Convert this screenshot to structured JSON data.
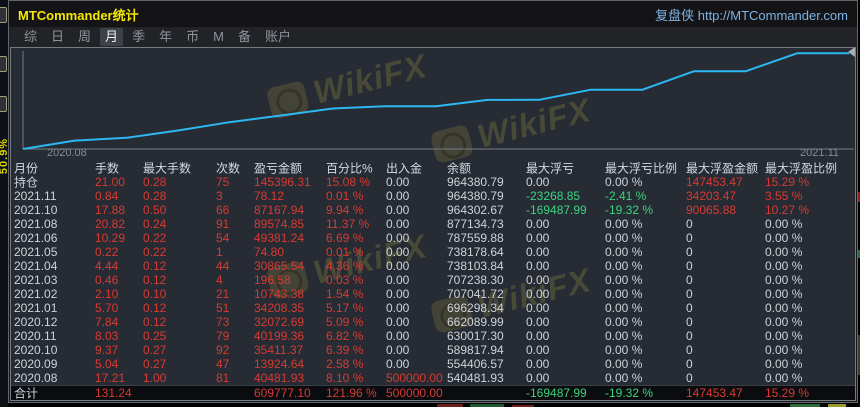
{
  "window": {
    "title": "MTCommander统计",
    "brand": "复盘侠 http://MTCommander.com"
  },
  "side_panel": {
    "label": "50.9%"
  },
  "menu": {
    "items": [
      {
        "label": "综",
        "active": false
      },
      {
        "label": "日",
        "active": false
      },
      {
        "label": "周",
        "active": false
      },
      {
        "label": "月",
        "active": true
      },
      {
        "label": "季",
        "active": false
      },
      {
        "label": "年",
        "active": false
      },
      {
        "label": "币",
        "active": false
      },
      {
        "label": "M",
        "active": false
      },
      {
        "label": "备",
        "active": false
      },
      {
        "label": "账户",
        "active": false
      }
    ]
  },
  "watermark": {
    "text": "WikiFX"
  },
  "chart_data": {
    "type": "line",
    "title": "",
    "xlabel": "",
    "ylabel": "",
    "x": [
      "2020.08",
      "2020.09",
      "2020.10",
      "2020.11",
      "2020.12",
      "2021.01",
      "2021.02",
      "2021.03",
      "2021.04",
      "2021.05",
      "2021.06",
      "2021.07",
      "2021.08",
      "2021.09",
      "2021.10",
      "2021.11"
    ],
    "x_tick_labels_shown": [
      "2020.08",
      "2021.11"
    ],
    "start_value": 500000.0,
    "series": [
      {
        "name": "余额",
        "values": [
          540481.93,
          554406.57,
          589817.94,
          630017.3,
          662089.99,
          696298.34,
          707041.72,
          707238.3,
          738103.84,
          738178.64,
          787559.88,
          787559.88,
          877134.73,
          877134.73,
          964302.67,
          964380.79
        ]
      }
    ],
    "ylim": [
      500000,
      970000
    ],
    "grid": false,
    "legend_position": "none",
    "line_color": "#2cb8f2"
  },
  "colors": {
    "title_yellow": "#f5e900",
    "brand_blue": "#7fb3e4",
    "profit_red": "#d83b32",
    "loss_green": "#3bd47e",
    "neutral_text": "#cfd3d9",
    "equity_line": "#2cb8f2"
  },
  "table": {
    "headers": [
      "月份",
      "手数",
      "最大手数",
      "次数",
      "盈亏金额",
      "百分比%",
      "出入金",
      "余额",
      "最大浮亏",
      "最大浮亏比例",
      "最大浮盈金额",
      "最大浮盈比例"
    ],
    "rows": [
      {
        "cells": [
          {
            "t": "持仓",
            "c": "l"
          },
          {
            "t": "21.00",
            "c": "r"
          },
          {
            "t": "0.28",
            "c": "r"
          },
          {
            "t": "75",
            "c": "r"
          },
          {
            "t": "145396.31",
            "c": "r"
          },
          {
            "t": "15.08 %",
            "c": "r"
          },
          {
            "t": "0.00",
            "c": "w"
          },
          {
            "t": "964380.79",
            "c": "w"
          },
          {
            "t": "0.00",
            "c": "w"
          },
          {
            "t": "0.00 %",
            "c": "w"
          },
          {
            "t": "147453.47",
            "c": "r"
          },
          {
            "t": "15.29 %",
            "c": "r"
          }
        ]
      },
      {
        "cells": [
          {
            "t": "2021.11",
            "c": "l"
          },
          {
            "t": "0.84",
            "c": "r"
          },
          {
            "t": "0.28",
            "c": "r"
          },
          {
            "t": "3",
            "c": "r"
          },
          {
            "t": "78.12",
            "c": "r"
          },
          {
            "t": "0.01 %",
            "c": "r"
          },
          {
            "t": "0.00",
            "c": "w"
          },
          {
            "t": "964380.79",
            "c": "w"
          },
          {
            "t": "-23268.85",
            "c": "g"
          },
          {
            "t": "-2.41 %",
            "c": "g"
          },
          {
            "t": "34203.47",
            "c": "r"
          },
          {
            "t": "3.55 %",
            "c": "r"
          }
        ]
      },
      {
        "cells": [
          {
            "t": "2021.10",
            "c": "l"
          },
          {
            "t": "17.88",
            "c": "r"
          },
          {
            "t": "0.50",
            "c": "r"
          },
          {
            "t": "66",
            "c": "r"
          },
          {
            "t": "87167.94",
            "c": "r"
          },
          {
            "t": "9.94 %",
            "c": "r"
          },
          {
            "t": "0.00",
            "c": "w"
          },
          {
            "t": "964302.67",
            "c": "w"
          },
          {
            "t": "-169487.99",
            "c": "g"
          },
          {
            "t": "-19.32 %",
            "c": "g"
          },
          {
            "t": "90065.88",
            "c": "r"
          },
          {
            "t": "10.27 %",
            "c": "r"
          }
        ]
      },
      {
        "cells": [
          {
            "t": "2021.08",
            "c": "l"
          },
          {
            "t": "20.82",
            "c": "r"
          },
          {
            "t": "0.24",
            "c": "r"
          },
          {
            "t": "91",
            "c": "r"
          },
          {
            "t": "89574.85",
            "c": "r"
          },
          {
            "t": "11.37 %",
            "c": "r"
          },
          {
            "t": "0.00",
            "c": "w"
          },
          {
            "t": "877134.73",
            "c": "w"
          },
          {
            "t": "0.00",
            "c": "w"
          },
          {
            "t": "0.00 %",
            "c": "w"
          },
          {
            "t": "0",
            "c": "w"
          },
          {
            "t": "0.00 %",
            "c": "w"
          }
        ]
      },
      {
        "cells": [
          {
            "t": "2021.06",
            "c": "l"
          },
          {
            "t": "10.29",
            "c": "r"
          },
          {
            "t": "0.22",
            "c": "r"
          },
          {
            "t": "54",
            "c": "r"
          },
          {
            "t": "49381.24",
            "c": "r"
          },
          {
            "t": "6.69 %",
            "c": "r"
          },
          {
            "t": "0.00",
            "c": "w"
          },
          {
            "t": "787559.88",
            "c": "w"
          },
          {
            "t": "0.00",
            "c": "w"
          },
          {
            "t": "0.00 %",
            "c": "w"
          },
          {
            "t": "0",
            "c": "w"
          },
          {
            "t": "0.00 %",
            "c": "w"
          }
        ]
      },
      {
        "cells": [
          {
            "t": "2021.05",
            "c": "l"
          },
          {
            "t": "0.22",
            "c": "r"
          },
          {
            "t": "0.22",
            "c": "r"
          },
          {
            "t": "1",
            "c": "r"
          },
          {
            "t": "74.80",
            "c": "r"
          },
          {
            "t": "0.01 %",
            "c": "r"
          },
          {
            "t": "0.00",
            "c": "w"
          },
          {
            "t": "738178.64",
            "c": "w"
          },
          {
            "t": "0.00",
            "c": "w"
          },
          {
            "t": "0.00 %",
            "c": "w"
          },
          {
            "t": "0",
            "c": "w"
          },
          {
            "t": "0.00 %",
            "c": "w"
          }
        ]
      },
      {
        "cells": [
          {
            "t": "2021.04",
            "c": "l"
          },
          {
            "t": "4.44",
            "c": "r"
          },
          {
            "t": "0.12",
            "c": "r"
          },
          {
            "t": "44",
            "c": "r"
          },
          {
            "t": "30865.54",
            "c": "r"
          },
          {
            "t": "4.36 %",
            "c": "r"
          },
          {
            "t": "0.00",
            "c": "w"
          },
          {
            "t": "738103.84",
            "c": "w"
          },
          {
            "t": "0.00",
            "c": "w"
          },
          {
            "t": "0.00 %",
            "c": "w"
          },
          {
            "t": "0",
            "c": "w"
          },
          {
            "t": "0.00 %",
            "c": "w"
          }
        ]
      },
      {
        "cells": [
          {
            "t": "2021.03",
            "c": "l"
          },
          {
            "t": "0.46",
            "c": "r"
          },
          {
            "t": "0.12",
            "c": "r"
          },
          {
            "t": "4",
            "c": "r"
          },
          {
            "t": "196.58",
            "c": "r"
          },
          {
            "t": "0.03 %",
            "c": "r"
          },
          {
            "t": "0.00",
            "c": "w"
          },
          {
            "t": "707238.30",
            "c": "w"
          },
          {
            "t": "0.00",
            "c": "w"
          },
          {
            "t": "0.00 %",
            "c": "w"
          },
          {
            "t": "0",
            "c": "w"
          },
          {
            "t": "0.00 %",
            "c": "w"
          }
        ]
      },
      {
        "cells": [
          {
            "t": "2021.02",
            "c": "l"
          },
          {
            "t": "2.10",
            "c": "r"
          },
          {
            "t": "0.10",
            "c": "r"
          },
          {
            "t": "21",
            "c": "r"
          },
          {
            "t": "10743.38",
            "c": "r"
          },
          {
            "t": "1.54 %",
            "c": "r"
          },
          {
            "t": "0.00",
            "c": "w"
          },
          {
            "t": "707041.72",
            "c": "w"
          },
          {
            "t": "0.00",
            "c": "w"
          },
          {
            "t": "0.00 %",
            "c": "w"
          },
          {
            "t": "0",
            "c": "w"
          },
          {
            "t": "0.00 %",
            "c": "w"
          }
        ]
      },
      {
        "cells": [
          {
            "t": "2021.01",
            "c": "l"
          },
          {
            "t": "5.70",
            "c": "r"
          },
          {
            "t": "0.12",
            "c": "r"
          },
          {
            "t": "51",
            "c": "r"
          },
          {
            "t": "34208.35",
            "c": "r"
          },
          {
            "t": "5.17 %",
            "c": "r"
          },
          {
            "t": "0.00",
            "c": "w"
          },
          {
            "t": "696298.34",
            "c": "w"
          },
          {
            "t": "0.00",
            "c": "w"
          },
          {
            "t": "0.00 %",
            "c": "w"
          },
          {
            "t": "0",
            "c": "w"
          },
          {
            "t": "0.00 %",
            "c": "w"
          }
        ]
      },
      {
        "cells": [
          {
            "t": "2020.12",
            "c": "l"
          },
          {
            "t": "7.84",
            "c": "r"
          },
          {
            "t": "0.12",
            "c": "r"
          },
          {
            "t": "73",
            "c": "r"
          },
          {
            "t": "32072.69",
            "c": "r"
          },
          {
            "t": "5.09 %",
            "c": "r"
          },
          {
            "t": "0.00",
            "c": "w"
          },
          {
            "t": "662089.99",
            "c": "w"
          },
          {
            "t": "0.00",
            "c": "w"
          },
          {
            "t": "0.00 %",
            "c": "w"
          },
          {
            "t": "0",
            "c": "w"
          },
          {
            "t": "0.00 %",
            "c": "w"
          }
        ]
      },
      {
        "cells": [
          {
            "t": "2020.11",
            "c": "l"
          },
          {
            "t": "8.03",
            "c": "r"
          },
          {
            "t": "0.25",
            "c": "r"
          },
          {
            "t": "79",
            "c": "r"
          },
          {
            "t": "40199.36",
            "c": "r"
          },
          {
            "t": "6.82 %",
            "c": "r"
          },
          {
            "t": "0.00",
            "c": "w"
          },
          {
            "t": "630017.30",
            "c": "w"
          },
          {
            "t": "0.00",
            "c": "w"
          },
          {
            "t": "0.00 %",
            "c": "w"
          },
          {
            "t": "0",
            "c": "w"
          },
          {
            "t": "0.00 %",
            "c": "w"
          }
        ]
      },
      {
        "cells": [
          {
            "t": "2020.10",
            "c": "l"
          },
          {
            "t": "9.37",
            "c": "r"
          },
          {
            "t": "0.27",
            "c": "r"
          },
          {
            "t": "92",
            "c": "r"
          },
          {
            "t": "35411.37",
            "c": "r"
          },
          {
            "t": "6.39 %",
            "c": "r"
          },
          {
            "t": "0.00",
            "c": "w"
          },
          {
            "t": "589817.94",
            "c": "w"
          },
          {
            "t": "0.00",
            "c": "w"
          },
          {
            "t": "0.00 %",
            "c": "w"
          },
          {
            "t": "0",
            "c": "w"
          },
          {
            "t": "0.00 %",
            "c": "w"
          }
        ]
      },
      {
        "cells": [
          {
            "t": "2020.09",
            "c": "l"
          },
          {
            "t": "5.04",
            "c": "r"
          },
          {
            "t": "0.27",
            "c": "r"
          },
          {
            "t": "47",
            "c": "r"
          },
          {
            "t": "13924.64",
            "c": "r"
          },
          {
            "t": "2.58 %",
            "c": "r"
          },
          {
            "t": "0.00",
            "c": "w"
          },
          {
            "t": "554406.57",
            "c": "w"
          },
          {
            "t": "0.00",
            "c": "w"
          },
          {
            "t": "0.00 %",
            "c": "w"
          },
          {
            "t": "0",
            "c": "w"
          },
          {
            "t": "0.00 %",
            "c": "w"
          }
        ]
      },
      {
        "cells": [
          {
            "t": "2020.08",
            "c": "l"
          },
          {
            "t": "17.21",
            "c": "r"
          },
          {
            "t": "1.00",
            "c": "r"
          },
          {
            "t": "81",
            "c": "r"
          },
          {
            "t": "40481.93",
            "c": "r"
          },
          {
            "t": "8.10 %",
            "c": "r"
          },
          {
            "t": "500000.00",
            "c": "r"
          },
          {
            "t": "540481.93",
            "c": "w"
          },
          {
            "t": "0.00",
            "c": "w"
          },
          {
            "t": "0.00 %",
            "c": "w"
          },
          {
            "t": "0",
            "c": "w"
          },
          {
            "t": "0.00 %",
            "c": "w"
          }
        ]
      },
      {
        "total": true,
        "cells": [
          {
            "t": "合计",
            "c": "l"
          },
          {
            "t": "131.24",
            "c": "r"
          },
          {
            "t": "",
            "c": "w"
          },
          {
            "t": "",
            "c": "w"
          },
          {
            "t": "609777.10",
            "c": "r"
          },
          {
            "t": "121.96 %",
            "c": "r"
          },
          {
            "t": "500000.00",
            "c": "r"
          },
          {
            "t": "",
            "c": "w"
          },
          {
            "t": "-169487.99",
            "c": "g"
          },
          {
            "t": "-19.32 %",
            "c": "g"
          },
          {
            "t": "147453.47",
            "c": "r"
          },
          {
            "t": "15.29 %",
            "c": "r"
          }
        ]
      }
    ]
  }
}
